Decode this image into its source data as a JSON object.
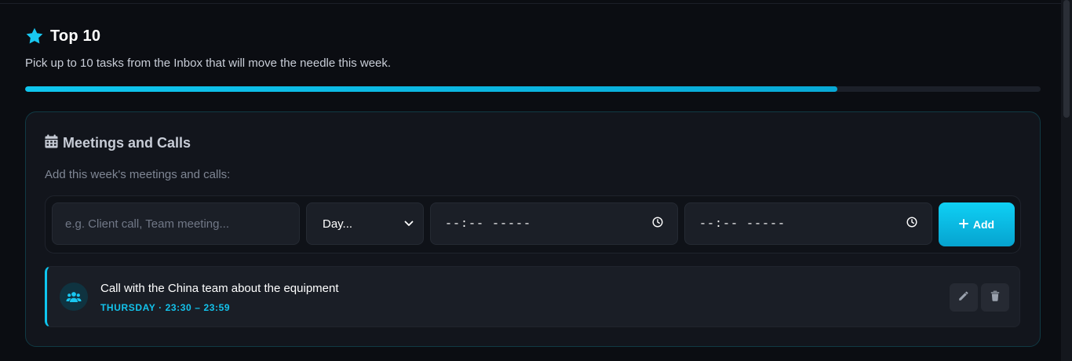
{
  "header": {
    "title": "Top 10",
    "subtitle": "Pick up to 10 tasks from the Inbox that will move the needle this week.",
    "progress_fraction": 0.8
  },
  "meetings_card": {
    "title": "Meetings and Calls",
    "hint": "Add this week's meetings and calls:",
    "form": {
      "name_placeholder": "e.g. Client call, Team meeting...",
      "day_selected": "Day...",
      "start_time_display": "--:-- -----",
      "end_time_display": "--:-- -----",
      "add_label": "Add"
    },
    "meetings": [
      {
        "title": "Call with the China team about the equipment",
        "meta": "THURSDAY · 23:30 – 23:59"
      }
    ]
  },
  "colors": {
    "accent": "#0ec6ef",
    "background": "#0b0d12",
    "card_border": "#103a44"
  },
  "icons": {
    "header": "star-icon",
    "card": "calendar-icon",
    "meeting": "people-icon",
    "edit": "pencil-icon",
    "delete": "trash-icon",
    "time": "clock-icon",
    "select": "chevron-down-icon",
    "add": "plus-icon"
  }
}
